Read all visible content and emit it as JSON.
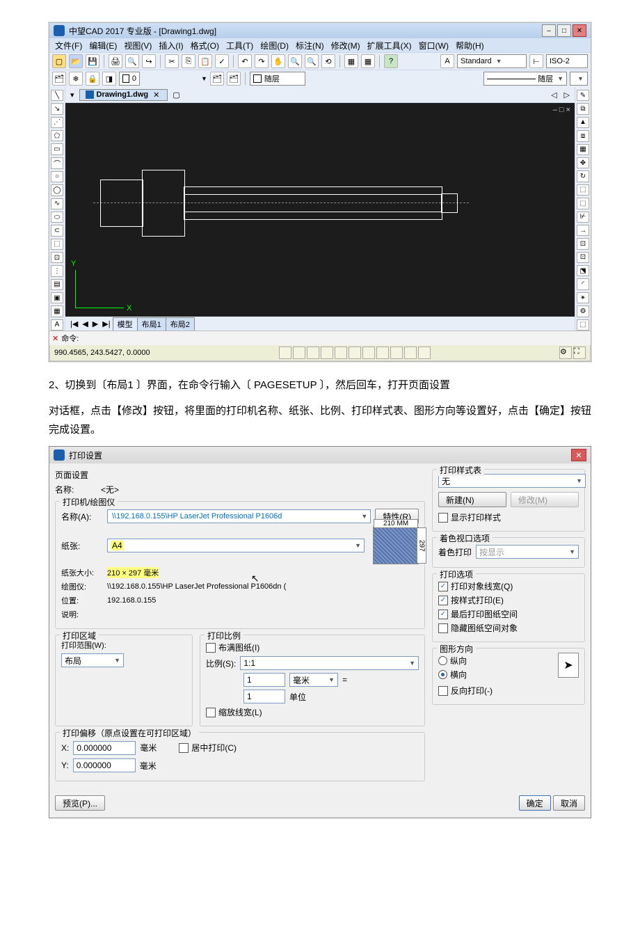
{
  "cad": {
    "title": "中望CAD 2017 专业版 - [Drawing1.dwg]",
    "menu": [
      "文件(F)",
      "编辑(E)",
      "视图(V)",
      "插入(I)",
      "格式(O)",
      "工具(T)",
      "绘图(D)",
      "标注(N)",
      "修改(M)",
      "扩展工具(X)",
      "窗口(W)",
      "帮助(H)"
    ],
    "style": "Standard",
    "iso": "ISO-2",
    "layer_combo": "随层",
    "layer0": "0",
    "layer0_chk": "随层",
    "doc_tab": "Drawing1.dwg",
    "axis_x": "X",
    "axis_y": "Y",
    "cmd_label": "命令:",
    "coords": "990.4565, 243.5427, 0.0000",
    "layout_tabs": {
      "model": "模型",
      "l1": "布局1",
      "l2": "布局2"
    },
    "undock": "– □ ×"
  },
  "para_step2": "2、切换到〔布局1 〕界面，在命令行输入〔 PAGESETUP 〕，然后回车，打开页面设置",
  "para_cont": "对话框，点击【修改】按钮，将里面的打印机名称、纸张、比例、打印样式表、图形方向等设置好，点击【确定】按钮完成设置。",
  "dlg": {
    "title": "打印设置",
    "page_setup": "页面设置",
    "name_lbl": "名称:",
    "name_val": "<无>",
    "printer_grp": "打印机/绘图仪",
    "pname_lbl": "名称(A):",
    "pname_val": "\\\\192.168.0.155\\HP LaserJet Professional P1606d",
    "props_btn": "特性(R)",
    "paper_lbl": "纸张:",
    "paper_val": "A4",
    "psize_lbl": "纸张大小:",
    "psize_val": "210 × 297 毫米",
    "plotter_lbl": "绘图仪:",
    "plotter_val": "\\\\192.168.0.155\\HP LaserJet Professional P1606dn (",
    "loc_lbl": "位置:",
    "loc_val": "192.168.0.155",
    "desc_lbl": "说明:",
    "preview_w": "210 MM",
    "preview_h": "297",
    "area_grp": "打印区域",
    "range_lbl": "打印范围(W):",
    "range_val": "布局",
    "scale_grp": "打印比例",
    "fit_chk": "布满图纸(I)",
    "scale_lbl": "比例(S):",
    "scale_val": "1:1",
    "unit_top": "1",
    "unit_sel": "毫米",
    "unit_eq": "=",
    "unit_bot": "1",
    "unit_lbl": "单位",
    "scalelw_chk": "缩放线宽(L)",
    "offset_grp": "打印偏移（原点设置在可打印区域）",
    "ox_lbl": "X:",
    "oy_lbl": "Y:",
    "o_val": "0.000000",
    "o_unit": "毫米",
    "center_chk": "居中打印(C)",
    "styletbl_grp": "打印样式表",
    "styletbl_val": "无",
    "new_btn": "新建(N)",
    "edit_btn": "修改(M)",
    "showstyle_chk": "显示打印样式",
    "shade_grp": "着色视口选项",
    "shade_lbl": "着色打印",
    "shade_val": "按显示",
    "opts_grp": "打印选项",
    "opt_lw": "打印对象线宽(Q)",
    "opt_style": "按样式打印(E)",
    "opt_last": "最后打印图纸空间",
    "opt_hide": "隐藏图纸空间对象",
    "orient_grp": "图形方向",
    "portrait": "纵向",
    "landscape": "横向",
    "upside": "反向打印(-)",
    "preview_btn": "预览(P)...",
    "ok_btn": "确定",
    "cancel_btn": "取消",
    "orient_glyph": "➤"
  }
}
